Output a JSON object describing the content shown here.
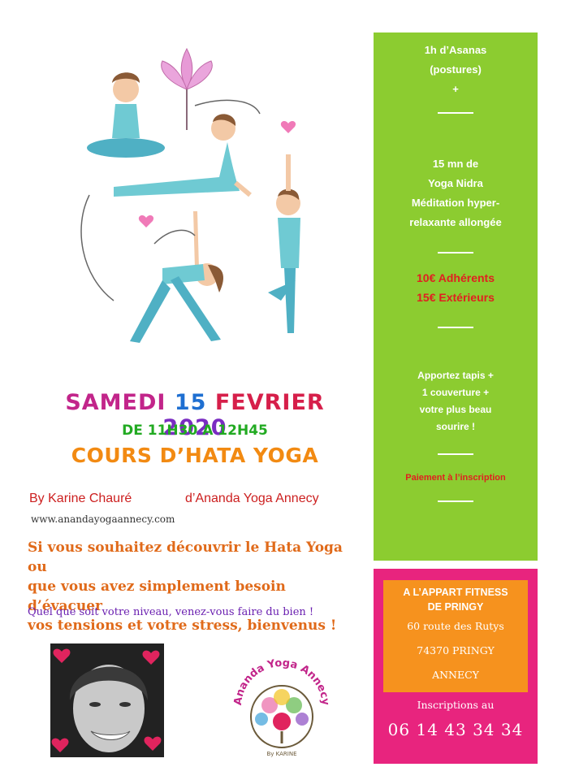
{
  "event": {
    "date_parts": [
      {
        "text": "SAMEDI",
        "color": "#c2258a"
      },
      {
        "text": "15",
        "color": "#1f6fd1"
      },
      {
        "text": "FEVRIER",
        "color": "#d61f4a"
      },
      {
        "text": "2020",
        "color": "#7a2cc2"
      }
    ],
    "time": "DE 11H30 A 12H45",
    "course_title": "COURS D’HATA YOGA",
    "by": "By Karine Chauré",
    "org": "d’Ananda Yoga Annecy",
    "website": "www.anandayogaannecy.com",
    "description": [
      "Si vous souhaitez découvrir le Hata Yoga ou",
      "que vous avez simplement besoin d’évacuer",
      "vos tensions et votre stress, bienvenus !"
    ],
    "level_note": "Quel que soit votre niveau, venez-vous faire du bien !"
  },
  "info_panel": {
    "asanas": [
      "1h d’Asanas",
      "(postures)",
      "+"
    ],
    "nidra": [
      "15 mn de",
      "Yoga Nidra",
      "Méditation hyper-",
      "relaxante allongée"
    ],
    "prices": [
      "10€ Adhérents",
      "15€ Extérieurs"
    ],
    "bring": [
      "Apportez tapis +",
      "1 couverture +",
      "votre plus beau",
      "sourire !"
    ],
    "payment": "Paiement à l’inscription"
  },
  "venue": {
    "name": [
      "A L’APPART FITNESS",
      "DE PRINGY"
    ],
    "address": [
      "60 route des Rutys",
      "74370 PRINGY",
      "ANNECY"
    ],
    "inscriptions_label": "Inscriptions au",
    "phone": "06 14 43 34 34"
  },
  "logo": {
    "text": "Ananda Yoga Annecy",
    "sub": "By KARINE"
  },
  "colors": {
    "green_panel": "#8ccc30",
    "pink_panel": "#e8247e",
    "orange_box": "#f6921e",
    "course_title": "#f28a12",
    "description": "#e06a1a"
  }
}
